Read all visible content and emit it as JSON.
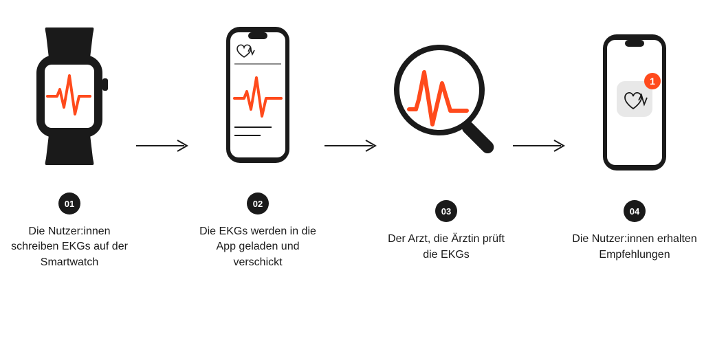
{
  "colors": {
    "accent": "#ff4a1c",
    "dark": "#1a1a1a",
    "light": "#ffffff",
    "iconbg": "#e8e8e8"
  },
  "steps": {
    "s1": {
      "number": "01",
      "caption": "Die Nutzer:innen schreiben EKGs auf der Smartwatch",
      "icon": "smartwatch-ekg-icon"
    },
    "s2": {
      "number": "02",
      "caption": "Die EKGs werden in die App geladen und verschickt",
      "icon": "phone-ekg-app-icon"
    },
    "s3": {
      "number": "03",
      "caption": "Der Arzt, die Ärztin prüft die EKGs",
      "icon": "magnifier-ekg-icon"
    },
    "s4": {
      "number": "04",
      "caption": "Die Nutzer:innen erhalten Empfehlungen",
      "icon": "phone-notification-icon",
      "notification_count": "1"
    }
  }
}
